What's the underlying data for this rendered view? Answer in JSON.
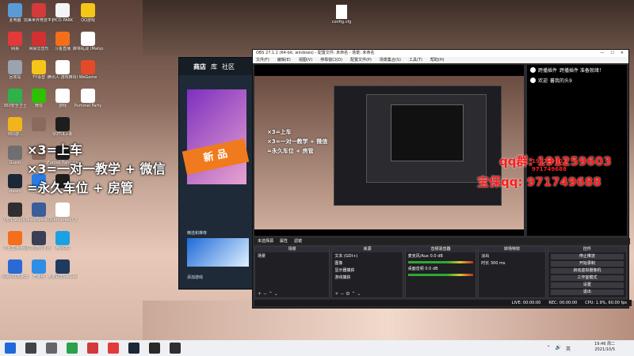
{
  "desktop_icons_col1": [
    {
      "label": "此电脑",
      "color": "#5b9bd5",
      "icon": "computer-icon"
    },
    {
      "label": "网易",
      "color": "#e03a3a",
      "icon": "netease-icon"
    },
    {
      "label": "回收站",
      "color": "#9aa4ae",
      "icon": "recycle-bin-icon"
    },
    {
      "label": "360安全卫士",
      "color": "#2fb24a",
      "icon": "shield-icon"
    },
    {
      "label": "360游...",
      "color": "#f1b41c",
      "icon": "game-icon"
    },
    {
      "label": "Guest",
      "color": "#6f6f6f",
      "icon": "guest-icon"
    },
    {
      "label": "steam",
      "color": "#1b2838",
      "icon": "steam-icon"
    },
    {
      "label": "OBS Studio",
      "color": "#302e31",
      "icon": "obs-icon"
    },
    {
      "label": "斗鱼直播伴侣",
      "color": "#f36f1c",
      "icon": "douyu-icon"
    },
    {
      "label": "网易UU加速器",
      "color": "#2a69d6",
      "icon": "uu-icon"
    }
  ],
  "desktop_icons_col2": [
    {
      "label": "完美世界竞技平台",
      "color": "#d43a3a",
      "icon": "perfect-world-icon"
    },
    {
      "label": "网易云音乐",
      "color": "#d33030",
      "icon": "music-icon"
    },
    {
      "label": "YY语音",
      "color": "#f5c518",
      "icon": "yy-icon"
    },
    {
      "label": "微信",
      "color": "#2dc100",
      "icon": "wechat-icon"
    },
    {
      "label": "",
      "color": "#8a6a5c",
      "icon": "blank-icon"
    },
    {
      "label": "",
      "color": "#8a6a5c",
      "icon": "blank-icon"
    },
    {
      "label": "迅雷影音",
      "color": "#2a7be4",
      "icon": "xunlei-icon"
    },
    {
      "label": "TeamSpeak 3",
      "color": "#3a5d9c",
      "icon": "teamspeak-icon"
    },
    {
      "label": "好玩游戏平台",
      "color": "#3a3f55",
      "icon": "haowan-icon"
    },
    {
      "label": "开播秘",
      "color": "#2f8de4",
      "icon": "kaibo-icon"
    }
  ],
  "desktop_icons_col3": [
    {
      "label": "PICO PARK",
      "color": "#f4f4f4",
      "icon": "pico-park-icon"
    },
    {
      "label": "斗鱼直播",
      "color": "#f36f1c",
      "icon": "douyu-live-icon"
    },
    {
      "label": "腾讯人·游戏推出版",
      "color": "#ffffff",
      "icon": "document-icon"
    },
    {
      "label": "游戏",
      "color": "#ffffff",
      "icon": "document-icon"
    },
    {
      "label": "SOTUL+新",
      "color": "#1e1e1e",
      "icon": "sotul-icon"
    },
    {
      "label": "Funnel Pancake",
      "color": "#1e1e1e",
      "icon": "funnel-icon"
    },
    {
      "label": "DEVOUR",
      "color": "#1e1e1e",
      "icon": "devour-icon"
    },
    {
      "label": "Overcooked! 2",
      "color": "#ffffff",
      "icon": "overcooked-icon"
    },
    {
      "label": "腾讯QQ",
      "color": "#1ba1e2",
      "icon": "qq-icon"
    },
    {
      "label": "英雄联盟WeGame版",
      "color": "#1e3a5f",
      "icon": "lol-icon"
    }
  ],
  "desktop_icons_col4": [
    {
      "label": "QQ游戏",
      "color": "#f5c518",
      "icon": "qq-game-icon"
    },
    {
      "label": "麻将乱战 (Mahjong...",
      "color": "#ffffff",
      "icon": "mahjong-icon"
    },
    {
      "label": "WeGame",
      "color": "#e44a2a",
      "icon": "wegame-icon"
    },
    {
      "label": "Pummel Party",
      "color": "#ffffff",
      "icon": "pummel-icon"
    }
  ],
  "file_icon": {
    "label": "config.cfg"
  },
  "overlay_lines": [
    "×3=上车",
    "×3=一对一教学 + 微信",
    "=永久车位 + 房管"
  ],
  "red_text": {
    "line1": "qq群: 191259603",
    "line2": "宝保qq: 971749688"
  },
  "store": {
    "tab_store": "商店",
    "tab_library": "库",
    "tab_community": "社区",
    "banner": "新 品",
    "featured": "精选和推荐",
    "add_game": "添加游戏"
  },
  "obs": {
    "title": "OBS 27.1.1 (64-bit, windows) - 配置文件: 未命名 - 场景: 未命名",
    "window_buttons": [
      "—",
      "☐",
      "✕"
    ],
    "menu": [
      "文件(F)",
      "编辑(E)",
      "视图(V)",
      "停靠窗口(D)",
      "配置文件(P)",
      "场景集合(S)",
      "工具(T)",
      "帮助(H)"
    ],
    "preview_overlays": [
      "×3=上车",
      "×3=一对一教学 + 微信",
      "=永久车位 + 房管"
    ],
    "chat": [
      {
        "name": "跨播插件",
        "msg": "跨播插件 准备就绪！"
      },
      {
        "name": "欢迎",
        "msg": "蕃我的头9"
      }
    ],
    "chat_red": {
      "line1": "191259603",
      "line2": "971749688"
    },
    "status_left": "未选择源",
    "status_props": "属性",
    "status_filter": "滤镜",
    "dock_scenes": "场景",
    "scene_item": "场景",
    "dock_sources": "来源",
    "sources": [
      "文本 (GDI+)",
      "图像",
      "显示器捕获",
      "游戏捕获"
    ],
    "dock_mixer": "音频混音器",
    "mixer_tracks": [
      {
        "name": "麦克风/Aux",
        "db": "0.0 dB"
      },
      {
        "name": "桌面音频",
        "db": "0.0 dB"
      }
    ],
    "dock_transitions": "转场特效",
    "transition_type": "淡出",
    "duration_label": "时长",
    "duration_value": "300 ms",
    "dock_controls": "控件",
    "controls": [
      "停止推流",
      "开始录制",
      "启动虚拟摄像机",
      "工作室模式",
      "设置",
      "退出"
    ],
    "statusbar": [
      "LIVE: 00:00:00",
      "REC: 00:00:00",
      "CPU: 1.9%, 60.00 fps"
    ]
  },
  "taskbar": {
    "time": "19:46 周二",
    "date": "2021/10/5",
    "search_icon": "search-icon"
  }
}
